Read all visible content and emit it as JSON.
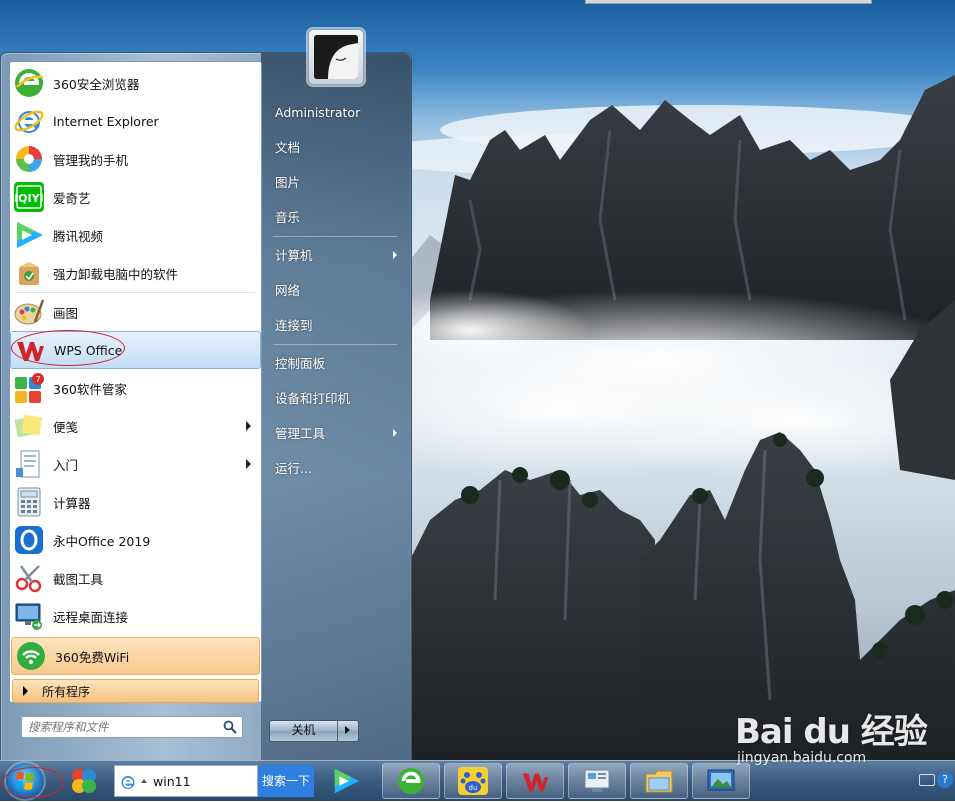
{
  "start_menu": {
    "programs": [
      {
        "label": "360安全浏览器",
        "icon": "360-browser-icon"
      },
      {
        "label": "Internet Explorer",
        "icon": "internet-explorer-icon"
      },
      {
        "label": "管理我的手机",
        "icon": "phone-manager-icon"
      },
      {
        "label": "爱奇艺",
        "icon": "iqiyi-icon"
      },
      {
        "label": "腾讯视频",
        "icon": "tencent-video-icon"
      },
      {
        "label": "强力卸载电脑中的软件",
        "icon": "uninstaller-icon"
      },
      {
        "label": "画图",
        "icon": "paint-icon"
      },
      {
        "label": "WPS Office",
        "icon": "wps-office-icon"
      },
      {
        "label": "360软件管家",
        "icon": "360-software-manager-icon"
      },
      {
        "label": "便笺",
        "icon": "sticky-notes-icon"
      },
      {
        "label": "入门",
        "icon": "getting-started-icon"
      },
      {
        "label": "计算器",
        "icon": "calculator-icon"
      },
      {
        "label": "永中Office 2019",
        "icon": "yozo-office-icon"
      },
      {
        "label": "截图工具",
        "icon": "snipping-tool-icon"
      },
      {
        "label": "远程桌面连接",
        "icon": "remote-desktop-icon"
      },
      {
        "label": "360免费WiFi",
        "icon": "360-wifi-icon"
      }
    ],
    "all_programs_label": "所有程序",
    "search_placeholder": "搜索程序和文件",
    "right_items": [
      {
        "label": "Administrator"
      },
      {
        "label": "文档"
      },
      {
        "label": "图片"
      },
      {
        "label": "音乐"
      },
      {
        "label": "计算机"
      },
      {
        "label": "网络"
      },
      {
        "label": "连接到"
      },
      {
        "label": "控制面板"
      },
      {
        "label": "设备和打印机"
      },
      {
        "label": "管理工具"
      },
      {
        "label": "运行..."
      }
    ],
    "shutdown_label": "关机"
  },
  "taskbar": {
    "address_text": "win11",
    "search_button_label": "搜索一下",
    "apps": [
      "tencent-video-icon",
      "360-browser-icon",
      "baidu-icon",
      "wps-office-icon",
      "control-panel-icon",
      "file-explorer-icon",
      "screenshot-icon"
    ]
  },
  "watermark": {
    "brand": "Bai du 经验",
    "url": "jingyan.baidu.com"
  },
  "colors": {
    "highlight_ring": "#d2232a",
    "wps_red": "#d2232a",
    "pinned_orange": "#f8c98e",
    "hover_blue": "#c4dcf6"
  }
}
